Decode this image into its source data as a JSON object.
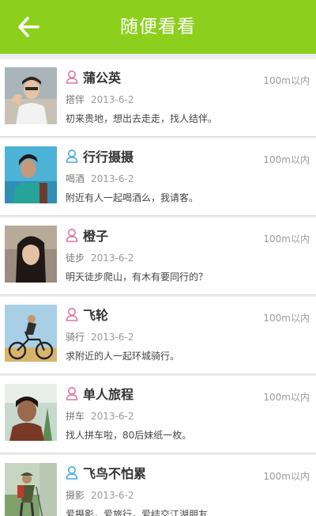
{
  "header": {
    "title": "随便看看",
    "back_icon": "arrow-left-icon"
  },
  "colors": {
    "accent": "#8ccf1d",
    "female": "#e0779b",
    "male": "#4aa8e0"
  },
  "items": [
    {
      "name": "蒲公英",
      "gender": "female",
      "activity": "搭伴",
      "date": "2013-6-2",
      "desc": "初来贵地，想出去走走，找人结伴。",
      "distance": "100m以内"
    },
    {
      "name": "行行摄摄",
      "gender": "male",
      "activity": "喝酒",
      "date": "2013-6-2",
      "desc": "附近有人一起喝酒么，我请客。",
      "distance": "100m以内"
    },
    {
      "name": "橙子",
      "gender": "female",
      "activity": "徒步",
      "date": "2013-6-2",
      "desc": "明天徒步爬山，有木有要同行的？",
      "distance": "100m以内"
    },
    {
      "name": "飞轮",
      "gender": "female",
      "activity": "骑行",
      "date": "2013-6-2",
      "desc": "求附近的人一起环城骑行。",
      "distance": "100m以内"
    },
    {
      "name": "单人旅程",
      "gender": "female",
      "activity": "拼车",
      "date": "2013-6-2",
      "desc": "找人拼车啦，80后妹纸一枚。",
      "distance": "100m以内"
    },
    {
      "name": "飞鸟不怕累",
      "gender": "male",
      "activity": "摄影",
      "date": "2013-6-2",
      "desc": "爱摄影，爱旅行，爱结交江湖朋友……",
      "distance": "100m以内"
    }
  ]
}
